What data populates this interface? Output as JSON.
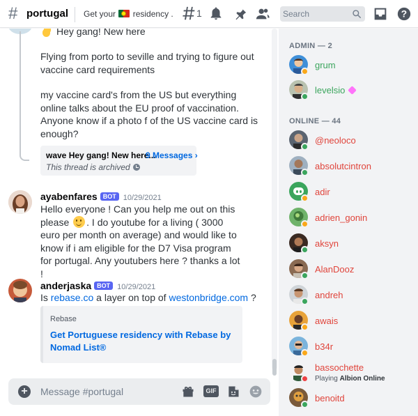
{
  "header": {
    "channel_name": "portugal",
    "topic_prefix": "Get your",
    "topic_suffix": "residency ...",
    "threads_count": "1",
    "search_placeholder": "Search"
  },
  "thread_message": {
    "greeting": "Hey gang! New here",
    "paragraph1": "Flying from porto to seville and trying to figure out vaccine card requirements",
    "paragraph2": "my vaccine card's from the US but everything online talks about the EU proof of vaccination. Anyone know if a photo f of the US vaccine card is enough?",
    "thread_title": "wave Hey gang! New here...",
    "thread_link": "9 Messages ›",
    "thread_status": "This thread is archived"
  },
  "messages": [
    {
      "author": "ayabenfares",
      "tag": "BOT",
      "timestamp": "10/29/2021",
      "text_before": "Hello everyone ! Can you help me out on this please",
      "text_after": ". I do youtube for a living ( 3000 euro per month on average) and would like to know if i am eligible for the D7 Visa program for portugal. Any youtubers here ? thanks a lot !"
    },
    {
      "author": "anderjaska",
      "tag": "BOT",
      "timestamp": "10/29/2021",
      "text_is": "Is",
      "link1": "rebase.co",
      "text_mid": "a layer on top of",
      "link2": "westonbridge.com",
      "text_end": "?"
    }
  ],
  "embed": {
    "provider": "Rebase",
    "title": "Get Portuguese residency with Rebase by Nomad List®"
  },
  "composer": {
    "placeholder": "Message #portugal",
    "gif_label": "GIF"
  },
  "members": {
    "admin_header": "ADMIN — 2",
    "online_header": "ONLINE — 44",
    "admins": [
      {
        "name": "grum",
        "color": "#3ba55d",
        "status": "idle"
      },
      {
        "name": "levelsio",
        "color": "#3ba55d",
        "status": "online"
      }
    ],
    "online": [
      {
        "name": "@neoloco",
        "color": "#e0443b",
        "status": "online"
      },
      {
        "name": "absolutcintron",
        "color": "#e0443b",
        "status": "online"
      },
      {
        "name": "adir",
        "color": "#e0443b",
        "status": "idle"
      },
      {
        "name": "adrien_gonin",
        "color": "#e0443b",
        "status": "idle"
      },
      {
        "name": "aksyn",
        "color": "#e0443b",
        "status": "online"
      },
      {
        "name": "AlanDooz",
        "color": "#e0443b",
        "status": "online"
      },
      {
        "name": "andreh",
        "color": "#e0443b",
        "status": "online"
      },
      {
        "name": "awais",
        "color": "#e0443b",
        "status": "idle"
      },
      {
        "name": "b34r",
        "color": "#e0443b",
        "status": "idle"
      },
      {
        "name": "bassochette",
        "color": "#e0443b",
        "status": "dnd",
        "activity_prefix": "Playing",
        "activity_game": "Albion Online"
      },
      {
        "name": "benoitd",
        "color": "#e0443b",
        "status": "online"
      }
    ]
  },
  "colors": {
    "online": "#3ba55d",
    "idle": "#faa81a",
    "dnd": "#ed4245",
    "link": "#0068e0",
    "bot_tag": "#5865f2"
  },
  "icons": [
    "hash-icon",
    "threads-icon",
    "bell-icon",
    "pin-icon",
    "members-icon",
    "search-icon",
    "inbox-icon",
    "help-icon",
    "plus-icon",
    "gift-icon",
    "gif-icon",
    "sticker-icon",
    "emoji-icon",
    "wave-emoji",
    "smiley-emoji",
    "clock-icon",
    "boost-icon"
  ]
}
